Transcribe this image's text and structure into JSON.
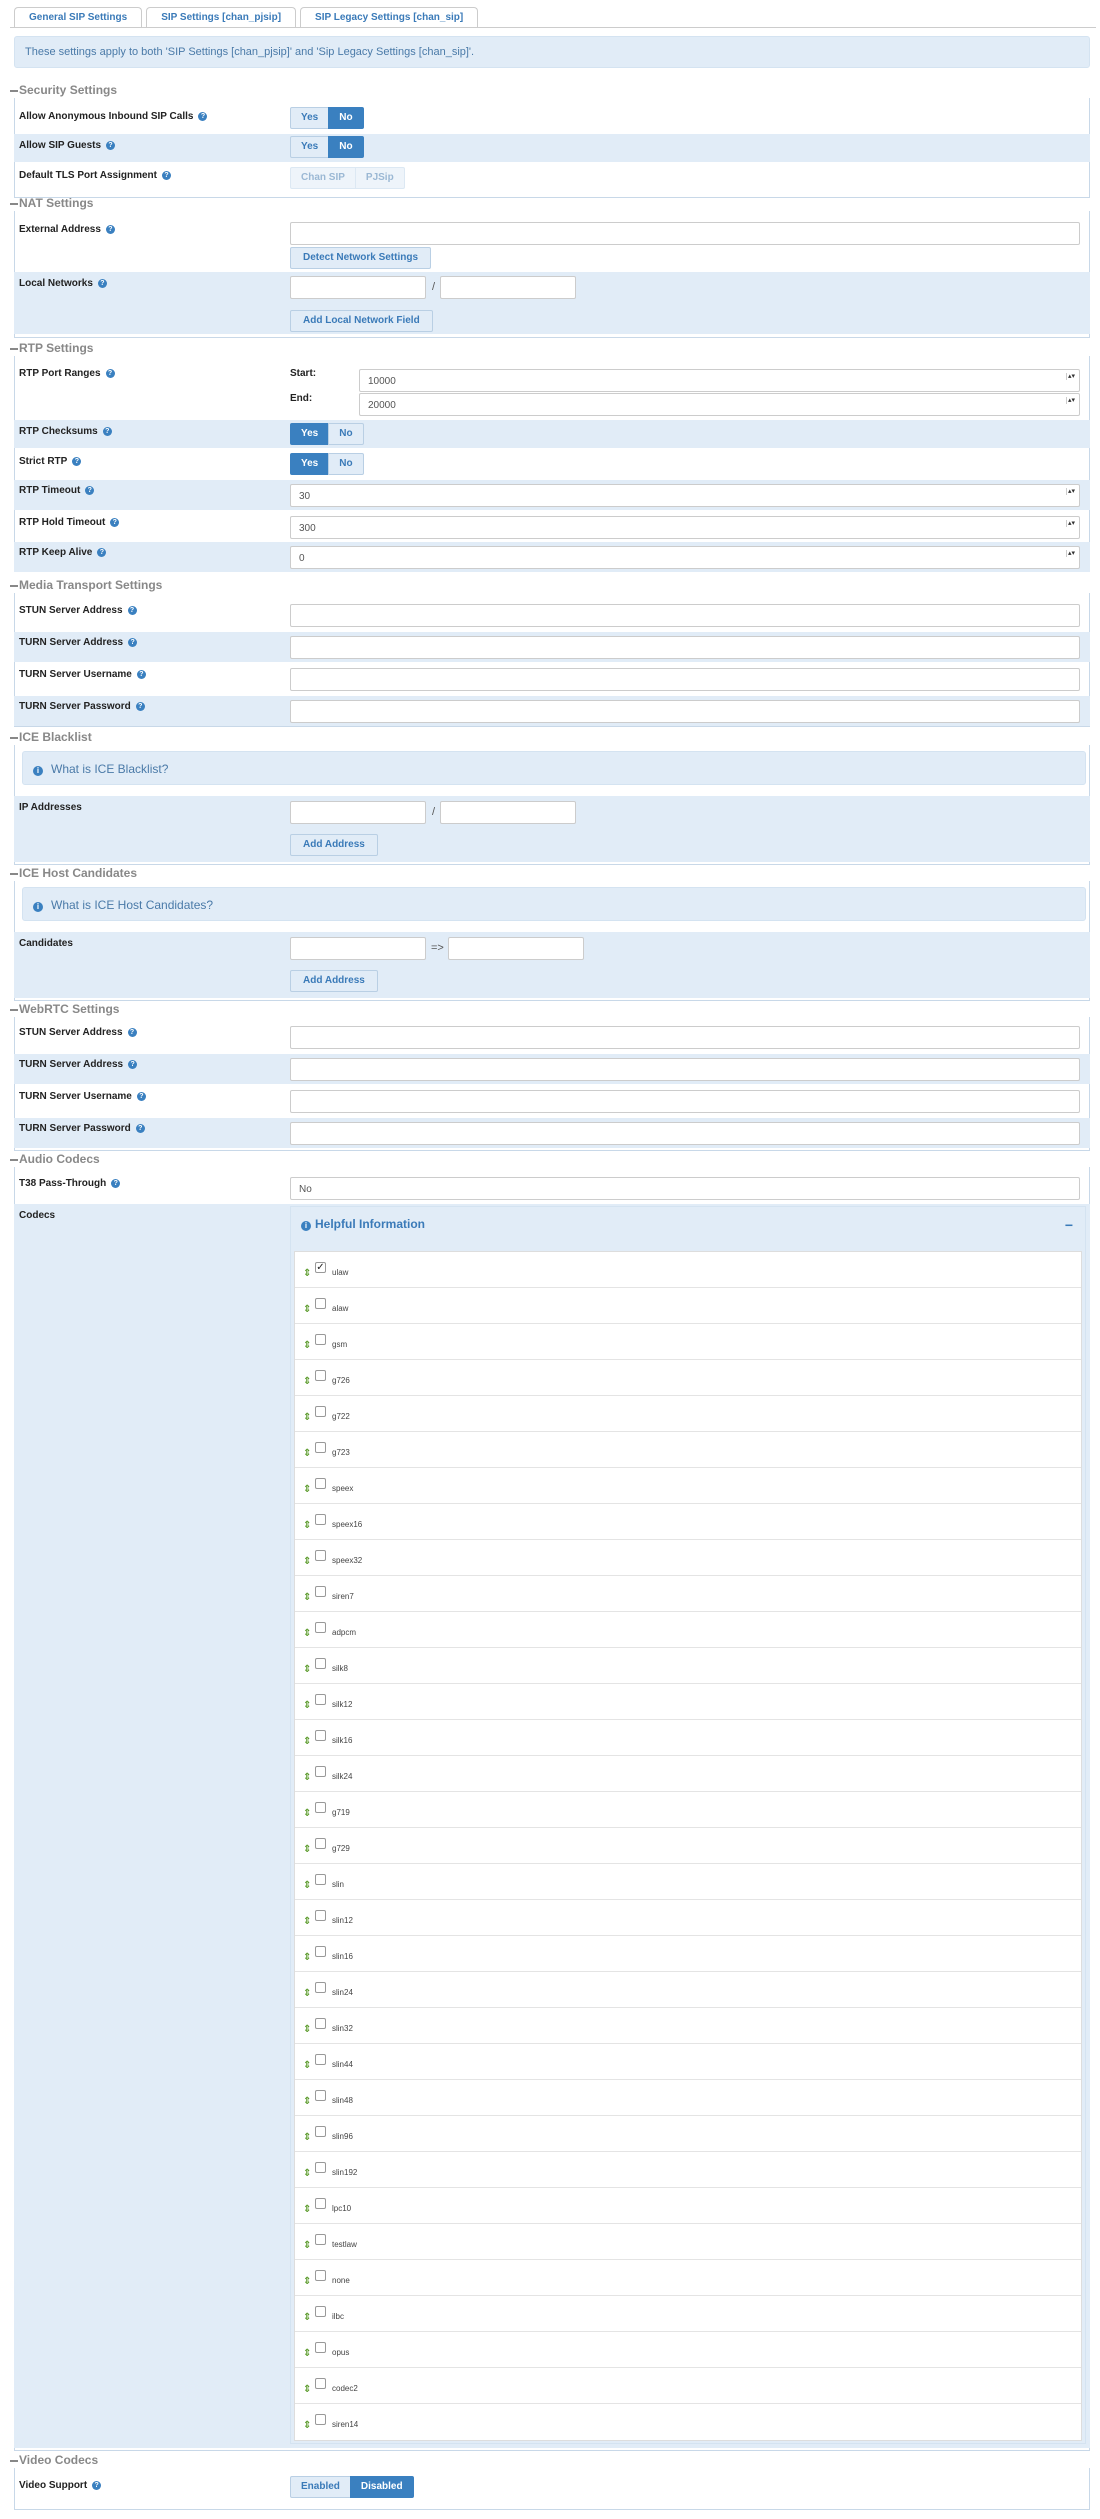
{
  "tabs": [
    {
      "label": "General SIP Settings"
    },
    {
      "label": "SIP Settings [chan_pjsip]"
    },
    {
      "label": "SIP Legacy Settings [chan_sip]"
    }
  ],
  "notice": "These settings apply to both 'SIP Settings [chan_pjsip]' and 'Sip Legacy Settings [chan_sip]'.",
  "help_glyph": "?",
  "info_glyph": "i",
  "yes": "Yes",
  "no": "No",
  "security": {
    "title": "Security Settings",
    "anon_label": "Allow Anonymous Inbound SIP Calls",
    "guests_label": "Allow SIP Guests",
    "tls_label": "Default TLS Port Assignment",
    "tls_opt1": "Chan SIP",
    "tls_opt2": "PJSip"
  },
  "nat": {
    "title": "NAT Settings",
    "ext_label": "External Address",
    "ext_value": "",
    "detect_label": "Detect Network Settings",
    "local_label": "Local Networks",
    "slash": "/",
    "add_local_label": "Add Local Network Field"
  },
  "rtp": {
    "title": "RTP Settings",
    "ports_label": "RTP Port Ranges",
    "start_label": "Start:",
    "start_value": "10000",
    "end_label": "End:",
    "end_value": "20000",
    "checksums_label": "RTP Checksums",
    "strict_label": "Strict RTP",
    "timeout_label": "RTP Timeout",
    "timeout_value": "30",
    "hold_label": "RTP Hold Timeout",
    "hold_value": "300",
    "keepalive_label": "RTP Keep Alive",
    "keepalive_value": "0"
  },
  "media": {
    "title": "Media Transport Settings",
    "stun_label": "STUN Server Address",
    "turn_label": "TURN Server Address",
    "turn_user_label": "TURN Server Username",
    "turn_pass_label": "TURN Server Password"
  },
  "ice": {
    "title": "ICE Blacklist",
    "info": "What is ICE Blacklist?",
    "ip_label": "IP Addresses",
    "slash": "/",
    "add_label": "Add Address"
  },
  "icehost": {
    "title": "ICE Host Candidates",
    "info": "What is ICE Host Candidates?",
    "cand_label": "Candidates",
    "arrow": "=>",
    "add_label": "Add Address"
  },
  "webrtc": {
    "title": "WebRTC Settings",
    "stun_label": "STUN Server Address",
    "turn_label": "TURN Server Address",
    "turn_user_label": "TURN Server Username",
    "turn_pass_label": "TURN Server Password"
  },
  "audio": {
    "title": "Audio Codecs",
    "t38_label": "T38 Pass-Through",
    "t38_value": "No",
    "codecs_label": "Codecs",
    "helpful": "Helpful Information",
    "collapse": "−",
    "check": "✓",
    "arrow_glyph": "⇕",
    "codecs": [
      {
        "name": "ulaw",
        "checked": true
      },
      {
        "name": "alaw",
        "checked": false
      },
      {
        "name": "gsm",
        "checked": false
      },
      {
        "name": "g726",
        "checked": false
      },
      {
        "name": "g722",
        "checked": false
      },
      {
        "name": "g723",
        "checked": false
      },
      {
        "name": "speex",
        "checked": false
      },
      {
        "name": "speex16",
        "checked": false
      },
      {
        "name": "speex32",
        "checked": false
      },
      {
        "name": "siren7",
        "checked": false
      },
      {
        "name": "adpcm",
        "checked": false
      },
      {
        "name": "silk8",
        "checked": false
      },
      {
        "name": "silk12",
        "checked": false
      },
      {
        "name": "silk16",
        "checked": false
      },
      {
        "name": "silk24",
        "checked": false
      },
      {
        "name": "g719",
        "checked": false
      },
      {
        "name": "g729",
        "checked": false
      },
      {
        "name": "slin",
        "checked": false
      },
      {
        "name": "slin12",
        "checked": false
      },
      {
        "name": "slin16",
        "checked": false
      },
      {
        "name": "slin24",
        "checked": false
      },
      {
        "name": "slin32",
        "checked": false
      },
      {
        "name": "slin44",
        "checked": false
      },
      {
        "name": "slin48",
        "checked": false
      },
      {
        "name": "slin96",
        "checked": false
      },
      {
        "name": "slin192",
        "checked": false
      },
      {
        "name": "lpc10",
        "checked": false
      },
      {
        "name": "testlaw",
        "checked": false
      },
      {
        "name": "none",
        "checked": false
      },
      {
        "name": "ilbc",
        "checked": false
      },
      {
        "name": "opus",
        "checked": false
      },
      {
        "name": "codec2",
        "checked": false
      },
      {
        "name": "siren14",
        "checked": false
      }
    ]
  },
  "video": {
    "title": "Video Codecs",
    "support_label": "Video Support",
    "enabled": "Enabled",
    "disabled": "Disabled"
  }
}
